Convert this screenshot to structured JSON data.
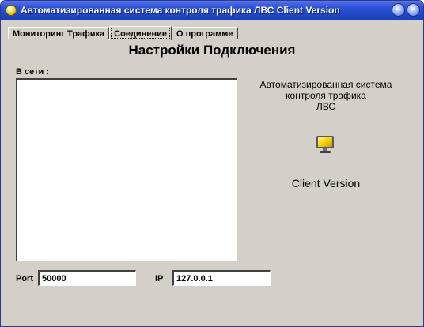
{
  "window": {
    "title": "Автоматизированная система контроля трафика ЛВС Client Version",
    "buttons": {
      "minimize_glyph": "–",
      "close_glyph": "✕"
    }
  },
  "tabs": [
    {
      "label": "Мониторинг Трафика",
      "active": false
    },
    {
      "label": "Соединение",
      "active": true
    },
    {
      "label": "О программе",
      "active": false
    }
  ],
  "panel": {
    "title": "Настройки Подключения",
    "online_label": "В сети :",
    "info_lines": [
      "Автоматизированная система",
      "контроля трафика",
      "ЛВС"
    ],
    "monitor_icon": "monitor-icon",
    "client_version": "Client Version",
    "port_label": "Port",
    "port_value": "50000",
    "ip_label": "IP",
    "ip_value": "127.0.0.1"
  },
  "colors": {
    "titlebar": "#2148c8",
    "face": "#d4d0c8",
    "field": "#ffffff"
  }
}
